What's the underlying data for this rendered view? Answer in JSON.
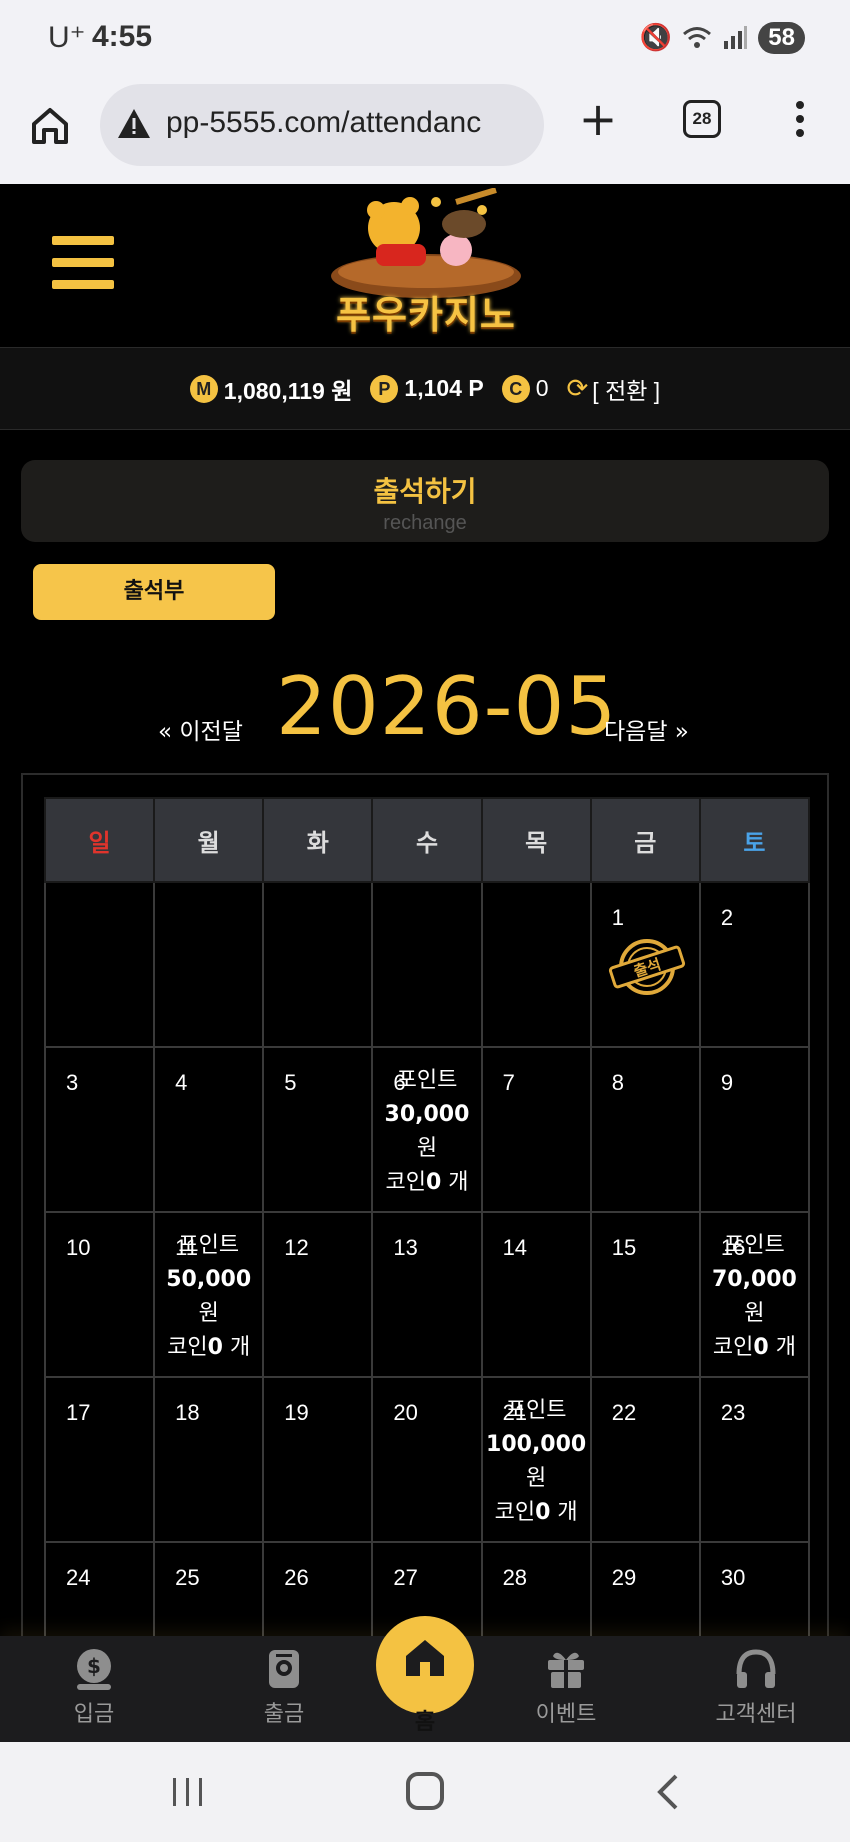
{
  "status_bar": {
    "carrier": "U⁺",
    "time": "4:55",
    "battery": "58"
  },
  "browser": {
    "url": "pp-5555.com/attendanc",
    "tab_count": "28"
  },
  "site": {
    "logo_text": "푸우카지노"
  },
  "balance": {
    "money_icon": "M",
    "money": "1,080,119 원",
    "point_icon": "P",
    "points": "1,104 P",
    "coin_icon": "C",
    "coins": "0",
    "convert_label": "[ 전환 ]"
  },
  "page": {
    "title": "출석하기",
    "subtitle": "rechange",
    "book_button": "출석부"
  },
  "month_nav": {
    "prev": "« 이전달",
    "current": "2026-05",
    "next": "다음달 »"
  },
  "calendar": {
    "weekdays": [
      "일",
      "월",
      "화",
      "수",
      "목",
      "금",
      "토"
    ],
    "weeks": [
      [
        {
          "day": ""
        },
        {
          "day": ""
        },
        {
          "day": ""
        },
        {
          "day": ""
        },
        {
          "day": ""
        },
        {
          "day": "1",
          "stamp": "출석"
        },
        {
          "day": "2"
        }
      ],
      [
        {
          "day": "3"
        },
        {
          "day": "4"
        },
        {
          "day": "5"
        },
        {
          "day": "6",
          "reward": {
            "l1": "포인트",
            "amount": "30,000",
            "l3": "원",
            "coin_prefix": "코인",
            "coin": "0",
            "coin_suffix": " 개"
          }
        },
        {
          "day": "7"
        },
        {
          "day": "8"
        },
        {
          "day": "9"
        }
      ],
      [
        {
          "day": "10"
        },
        {
          "day": "11",
          "reward": {
            "l1": "포인트",
            "amount": "50,000",
            "l3": "원",
            "coin_prefix": "코인",
            "coin": "0",
            "coin_suffix": " 개"
          }
        },
        {
          "day": "12"
        },
        {
          "day": "13"
        },
        {
          "day": "14"
        },
        {
          "day": "15"
        },
        {
          "day": "16",
          "reward": {
            "l1": "포인트",
            "amount": "70,000",
            "l3": "원",
            "coin_prefix": "코인",
            "coin": "0",
            "coin_suffix": " 개"
          }
        }
      ],
      [
        {
          "day": "17"
        },
        {
          "day": "18"
        },
        {
          "day": "19"
        },
        {
          "day": "20"
        },
        {
          "day": "21",
          "reward": {
            "l1": "포인트",
            "amount": "100,000",
            "l3": "원",
            "coin_prefix": "코인",
            "coin": "0",
            "coin_suffix": " 개"
          }
        },
        {
          "day": "22"
        },
        {
          "day": "23"
        }
      ],
      [
        {
          "day": "24"
        },
        {
          "day": "25"
        },
        {
          "day": "26"
        },
        {
          "day": "27"
        },
        {
          "day": "28"
        },
        {
          "day": "29"
        },
        {
          "day": "30"
        }
      ]
    ]
  },
  "bottom_nav": [
    {
      "label": "입금",
      "icon": "deposit-icon"
    },
    {
      "label": "출금",
      "icon": "withdraw-icon"
    },
    {
      "label": "홈",
      "icon": "home-icon"
    },
    {
      "label": "이벤트",
      "icon": "gift-icon"
    },
    {
      "label": "고객센터",
      "icon": "headset-icon"
    }
  ],
  "colors": {
    "accent": "#f4c242",
    "sunday": "#e0342c",
    "saturday": "#4aa3e8"
  }
}
